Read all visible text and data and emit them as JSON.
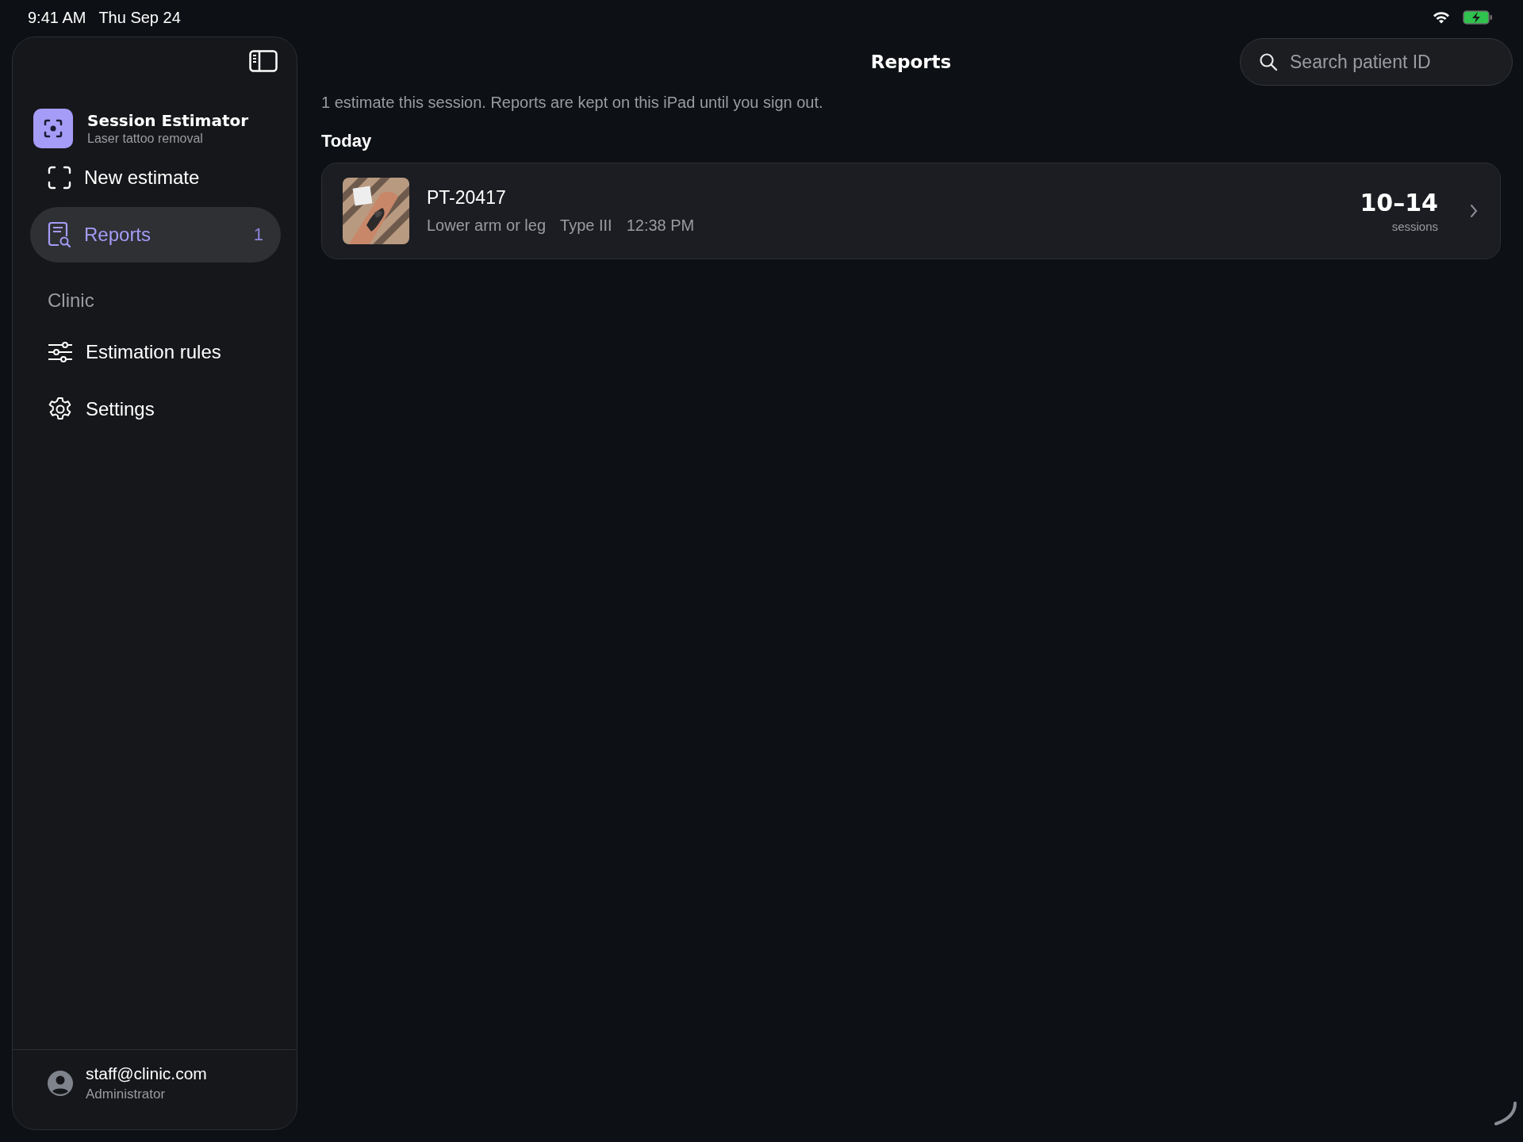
{
  "status_bar": {
    "time": "9:41 AM",
    "date": "Thu Sep 24"
  },
  "sidebar": {
    "app": {
      "name": "Session Estimator",
      "subtitle": "Laser tattoo removal"
    },
    "items": [
      {
        "label": "New estimate",
        "kind": "scan",
        "selected": false
      },
      {
        "label": "Reports",
        "kind": "report",
        "selected": true,
        "badge": "1"
      }
    ],
    "section": "Clinic",
    "clinic_items": [
      {
        "label": "Estimation rules",
        "kind": "sliders",
        "selected": false
      },
      {
        "label": "Settings",
        "kind": "gear",
        "selected": false
      }
    ],
    "account": {
      "email": "staff@clinic.com",
      "role": "Administrator"
    }
  },
  "main": {
    "title": "Reports",
    "search": {
      "placeholder": "Search patient ID"
    },
    "summary": "1 estimate this session. Reports are kept on this iPad until you sign out.",
    "groups": [
      {
        "heading": "Today",
        "reports": [
          {
            "patient_id": "PT-20417",
            "region": "Lower arm or leg",
            "skin_type": "Type III",
            "time": "12:38 PM",
            "sessions": "10–14",
            "sessions_label": "sessions"
          }
        ]
      }
    ]
  }
}
